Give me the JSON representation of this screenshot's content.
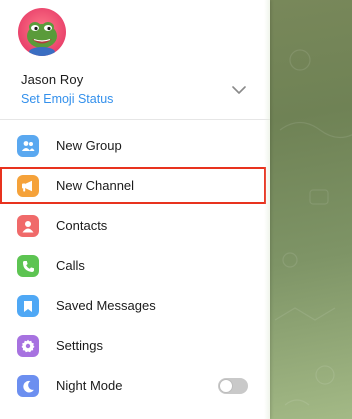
{
  "profile": {
    "name": "Jason Roy",
    "status_link": "Set Emoji Status",
    "avatar_icon": "pepe-frog-avatar"
  },
  "menu": [
    {
      "label": "New Group",
      "icon": "group-icon",
      "color": "#5aa8f0"
    },
    {
      "label": "New Channel",
      "icon": "megaphone-icon",
      "color": "#f5a23a"
    },
    {
      "label": "Contacts",
      "icon": "contact-icon",
      "color": "#f06a6a"
    },
    {
      "label": "Calls",
      "icon": "phone-icon",
      "color": "#5dc452"
    },
    {
      "label": "Saved Messages",
      "icon": "bookmark-icon",
      "color": "#4fa8f5"
    },
    {
      "label": "Settings",
      "icon": "gear-icon",
      "color": "#a772e0"
    },
    {
      "label": "Night Mode",
      "icon": "moon-icon",
      "color": "#6c8ff0",
      "toggle": false
    }
  ],
  "colors": {
    "accent": "#3390ec",
    "highlight_border": "#e8321e"
  }
}
